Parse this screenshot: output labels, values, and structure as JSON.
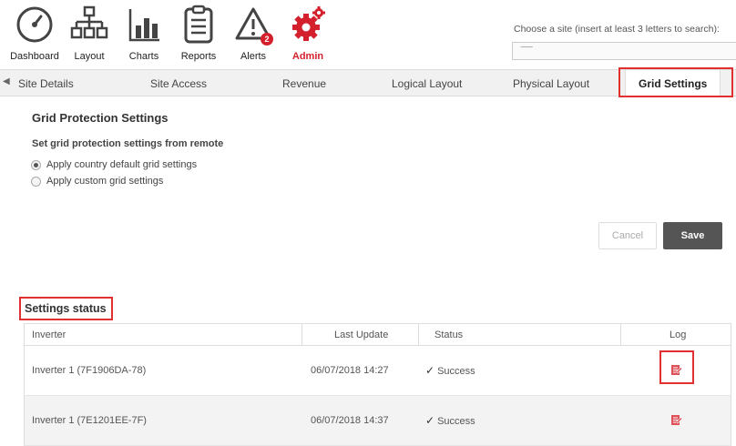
{
  "nav": {
    "items": [
      {
        "label": "Dashboard",
        "icon": "dashboard-gauge-icon"
      },
      {
        "label": "Layout",
        "icon": "layout-tree-icon"
      },
      {
        "label": "Charts",
        "icon": "bar-chart-icon"
      },
      {
        "label": "Reports",
        "icon": "clipboard-icon"
      },
      {
        "label": "Alerts",
        "icon": "warning-triangle-icon",
        "badge": "2"
      },
      {
        "label": "Admin",
        "icon": "gears-icon",
        "active": true
      }
    ]
  },
  "site_search": {
    "label": "Choose a site (insert at least 3 letters to search):",
    "value": "˜˜˜˜"
  },
  "tabs": [
    "Site Details",
    "Site Access",
    "Revenue",
    "Logical Layout",
    "Physical Layout",
    "Grid Settings"
  ],
  "active_tab": "Grid Settings",
  "grid_protection": {
    "title": "Grid Protection Settings",
    "subtitle": "Set grid protection settings from remote",
    "options": [
      {
        "label": "Apply country default grid settings",
        "checked": true
      },
      {
        "label": "Apply custom grid settings",
        "checked": false
      }
    ]
  },
  "buttons": {
    "cancel": "Cancel",
    "save": "Save"
  },
  "settings_status": {
    "title": "Settings status",
    "columns": [
      "Inverter",
      "Last Update",
      "Status",
      "Log"
    ],
    "rows": [
      {
        "inverter": "Inverter 1 (7F1906DA-78)",
        "last_update": "06/07/2018 14:27",
        "status": "Success"
      },
      {
        "inverter": "Inverter 1 (7E1201EE-7F)",
        "last_update": "06/07/2018 14:37",
        "status": "Success"
      }
    ]
  },
  "colors": {
    "accent": "#d4202c",
    "highlight_box": "#e03030",
    "save_button": "#555555"
  }
}
